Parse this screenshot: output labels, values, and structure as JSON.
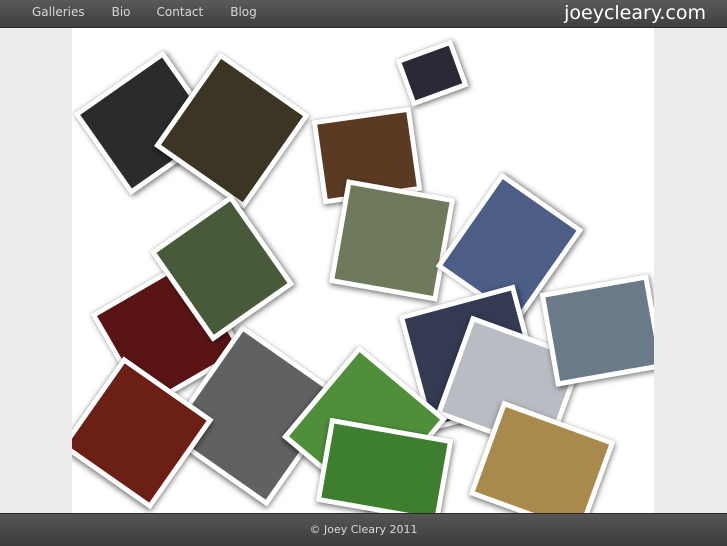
{
  "nav": {
    "items": [
      {
        "label": "Galleries"
      },
      {
        "label": "Bio"
      },
      {
        "label": "Contact"
      },
      {
        "label": "Blog"
      }
    ]
  },
  "brand": {
    "name": "joeycleary.com"
  },
  "collage": {
    "photos": [
      {
        "name": "photo-dark-room-window",
        "color": "#2b2b2b"
      },
      {
        "name": "photo-night-street-lamps",
        "color": "#3d3524"
      },
      {
        "name": "photo-temple-bells",
        "color": "#5a3a22"
      },
      {
        "name": "photo-mountain-valley",
        "color": "#6f7a5c"
      },
      {
        "name": "photo-red-sculpture",
        "color": "#4c5d86"
      },
      {
        "name": "photo-red-neon-sign",
        "color": "#5a1414"
      },
      {
        "name": "photo-city-rooftops",
        "color": "#5f6163"
      },
      {
        "name": "photo-red-temple-roof",
        "color": "#343a52"
      },
      {
        "name": "photo-taipei-101-tower",
        "color": "#b9bcc2"
      },
      {
        "name": "photo-green-tea-field",
        "color": "#4f8f3a"
      },
      {
        "name": "photo-yellow-leaf-moss",
        "color": "#3d7f2e"
      },
      {
        "name": "photo-street-signs",
        "color": "#6a7a88"
      },
      {
        "name": "photo-night-lights",
        "color": "#2a2a36"
      },
      {
        "name": "photo-straw-hillside",
        "color": "#a98a4c"
      },
      {
        "name": "photo-red-lanterns",
        "color": "#6c1f14"
      },
      {
        "name": "photo-forest-path",
        "color": "#495a3a"
      }
    ]
  },
  "footer": {
    "copyright": "© Joey Cleary 2011"
  }
}
